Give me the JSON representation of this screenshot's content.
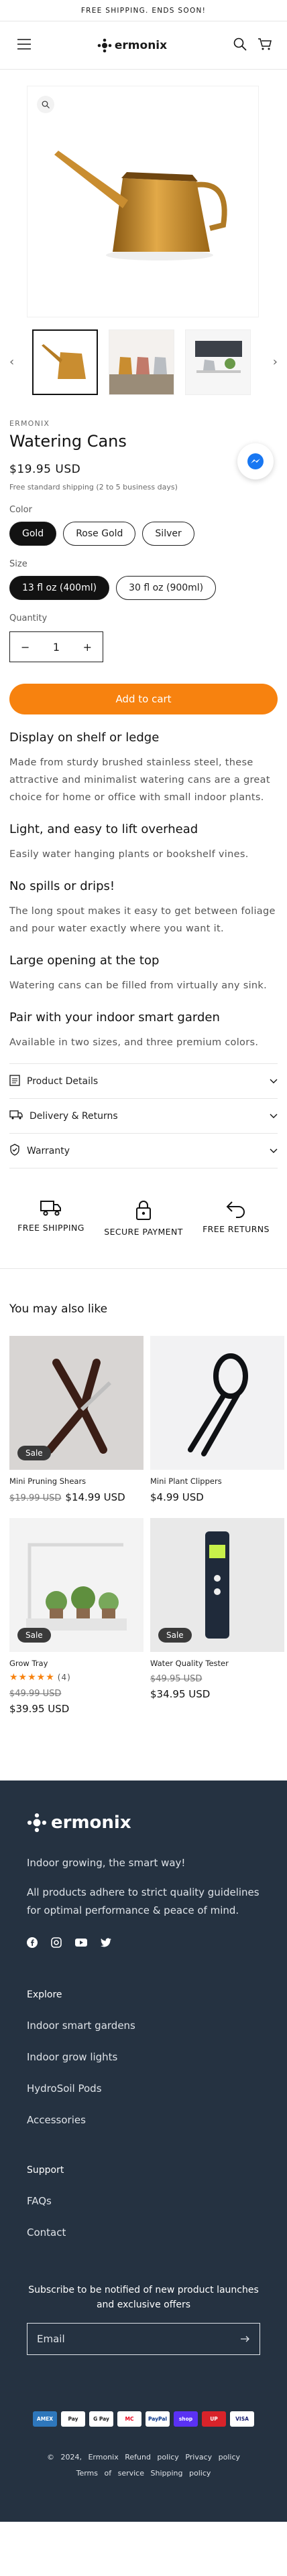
{
  "announcement": "FREE SHIPPING. ENDS SOON!",
  "header": {
    "logo": "ermonix",
    "menu_icon": "hamburger-icon",
    "search_icon": "search-icon",
    "cart_icon": "cart-icon"
  },
  "product": {
    "brand": "ERMONIX",
    "title": "Watering Cans",
    "price": "$19.95 USD",
    "shipping": "Free standard shipping (2 to 5 business days)",
    "color_label": "Color",
    "colors": [
      "Gold",
      "Rose Gold",
      "Silver"
    ],
    "selected_color": "Gold",
    "size_label": "Size",
    "sizes": [
      "13 fl oz (400ml)",
      "30 fl oz (900ml)"
    ],
    "selected_size": "13 fl oz (400ml)",
    "quantity_label": "Quantity",
    "quantity": "1",
    "add_to_cart": "Add to cart"
  },
  "description": [
    {
      "heading": "Display on shelf or ledge",
      "text": "Made from sturdy brushed stainless steel, these attractive and minimalist watering cans are a great choice for home or office with small indoor plants."
    },
    {
      "heading": "Light, and easy to lift overhead",
      "text": "Easily water hanging plants or bookshelf vines."
    },
    {
      "heading": "No spills or drips!",
      "text": "The long spout makes it easy to get between foliage and pour water exactly where you want it."
    },
    {
      "heading": "Large opening at the top",
      "text": "Watering cans can be filled from virtually any sink."
    },
    {
      "heading": "Pair with your indoor smart garden",
      "text": "Available in two sizes, and three premium colors."
    }
  ],
  "accordion": [
    "Product Details",
    "Delivery & Returns",
    "Warranty"
  ],
  "features": [
    "FREE SHIPPING",
    "SECURE PAYMENT",
    "FREE RETURNS"
  ],
  "related": {
    "title": "You may also like",
    "items": [
      {
        "name": "Mini Pruning Shears",
        "old": "$19.99 USD",
        "price": "$14.99 USD",
        "badge": "Sale"
      },
      {
        "name": "Mini Plant Clippers",
        "old": "",
        "price": "$4.99 USD",
        "badge": ""
      },
      {
        "name": "Grow Tray",
        "old": "$49.99 USD",
        "price": "$39.95 USD",
        "badge": "Sale",
        "rating": "(4)"
      },
      {
        "name": "Water Quality Tester",
        "old": "$49.95 USD",
        "price": "$34.95 USD",
        "badge": "Sale"
      }
    ]
  },
  "footer": {
    "logo": "ermonix",
    "tagline": "Indoor growing, the smart way!",
    "description": "All products adhere to strict quality guidelines for optimal performance & peace of mind.",
    "explore_title": "Explore",
    "explore_links": [
      "Indoor smart gardens",
      "Indoor grow lights",
      "HydroSoil Pods",
      "Accessories"
    ],
    "support_title": "Support",
    "support_links": [
      "FAQs",
      "Contact"
    ],
    "subscribe_text": "Subscribe to be notified of new product launches and exclusive offers",
    "email_placeholder": "Email",
    "payments": [
      "AMEX",
      "Pay",
      "G Pay",
      "MC",
      "PayPal",
      "shop",
      "UP",
      "VISA"
    ],
    "copyright": "© 2024, Ermonix",
    "legal": [
      "Refund policy",
      "Privacy policy",
      "Terms of service",
      "Shipping policy"
    ]
  },
  "colors": {
    "accent": "#f7820f",
    "footer_bg": "#253241",
    "selected_pill": "#121212"
  }
}
